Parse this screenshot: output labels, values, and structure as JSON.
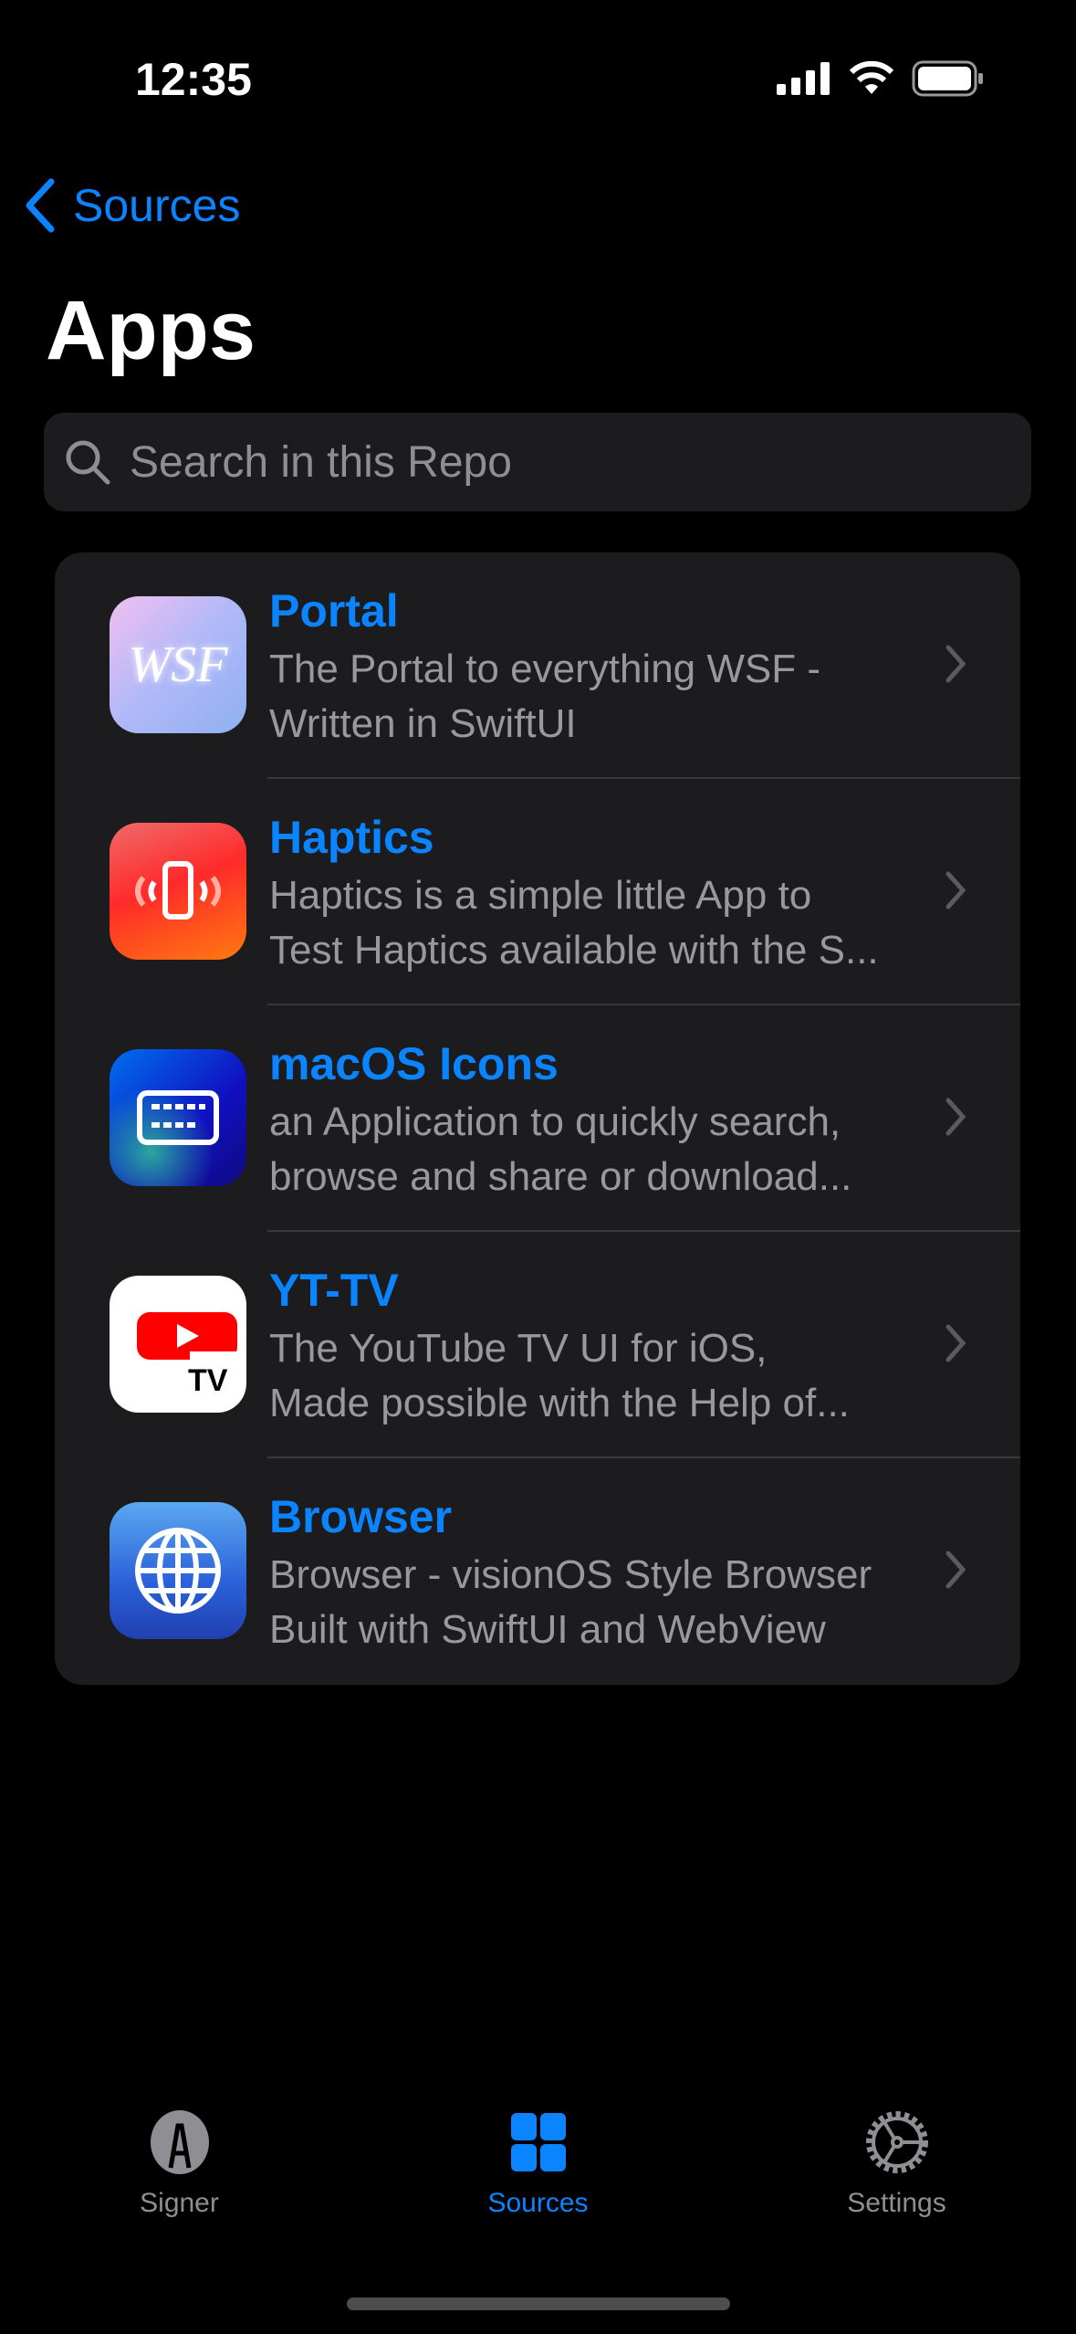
{
  "status": {
    "time": "12:35"
  },
  "nav": {
    "back_label": "Sources",
    "title": "Apps"
  },
  "search": {
    "placeholder": "Search in this Repo",
    "value": ""
  },
  "apps": [
    {
      "name": "Portal",
      "desc1": "The Portal to everything WSF -",
      "desc2": "Written in SwiftUI",
      "icon": "wsf-logo",
      "logo_text": "WSF"
    },
    {
      "name": "Haptics",
      "desc1": "Haptics is a simple little App to",
      "desc2": "Test Haptics available with the S...",
      "icon": "phone-vibrate-icon"
    },
    {
      "name": "macOS Icons",
      "desc1": "an Application to quickly search,",
      "desc2": "browse and share or download...",
      "icon": "keyboard-icon"
    },
    {
      "name": "YT-TV",
      "desc1": "The YouTube TV UI for iOS,",
      "desc2": "Made possible with the Help of...",
      "icon": "youtube-tv-logo",
      "logo_text": "TV"
    },
    {
      "name": "Browser",
      "desc1": "Browser - visionOS Style Browser",
      "desc2": "Built with SwiftUI and WebView",
      "icon": "globe-icon"
    }
  ],
  "tabs": [
    {
      "label": "Signer"
    },
    {
      "label": "Sources",
      "active": true
    },
    {
      "label": "Settings"
    }
  ],
  "colors": {
    "accent": "#0a84ff",
    "background": "#000000",
    "card": "#1c1c1e"
  }
}
